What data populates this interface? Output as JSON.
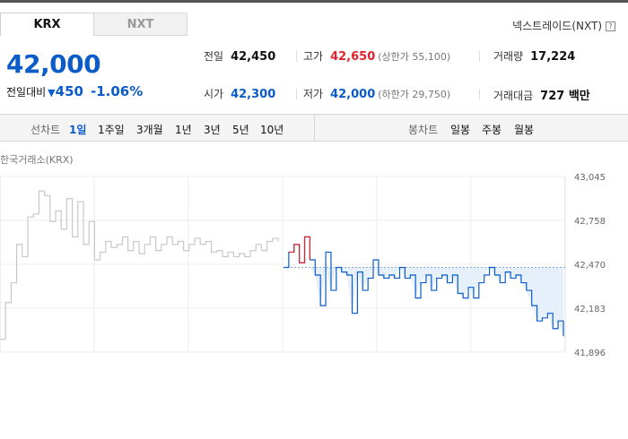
{
  "tabs": [
    {
      "label": "KRX",
      "active": true
    },
    {
      "label": "NXT",
      "active": false
    }
  ],
  "nxt_link": "넥스트레이드(NXT)",
  "price": "42,000",
  "change": {
    "label": "전일대비",
    "value": "450",
    "percent": "-1.06%"
  },
  "stats": {
    "prev_close": {
      "label": "전일",
      "value": "42,450"
    },
    "high": {
      "label": "고가",
      "value": "42,650",
      "sub_label": "(상한가 55,100)"
    },
    "volume": {
      "label": "거래량",
      "value": "17,224"
    },
    "open": {
      "label": "시가",
      "value": "42,300"
    },
    "low": {
      "label": "저가",
      "value": "42,000",
      "sub_label": "(하한가 29,750)"
    },
    "turnover": {
      "label": "거래대금",
      "value": "727 백만"
    }
  },
  "line_chart": {
    "label": "선차트",
    "periods": [
      "1일",
      "1주일",
      "3개월",
      "1년",
      "3년",
      "5년",
      "10년"
    ],
    "active": "1일"
  },
  "candle_chart": {
    "label": "봉차트",
    "periods": [
      "일봉",
      "주봉",
      "월봉"
    ]
  },
  "exchange_label": "한국거래소(KRX)",
  "colors": {
    "accent": "#0b5cc9",
    "up": "#e0242e",
    "prev_day": "#c8c8c8",
    "fill": "#e3eefb"
  },
  "chart_data": {
    "type": "line",
    "ylim": [
      41896,
      43045
    ],
    "yticks": [
      "43,045",
      "42,758",
      "42,470",
      "42,183",
      "41,896"
    ],
    "reference": 42450,
    "prev_day": [
      41980,
      42220,
      42350,
      42600,
      42520,
      42780,
      42800,
      42950,
      42920,
      42750,
      42820,
      42700,
      42900,
      42650,
      42880,
      42600,
      42750,
      42500,
      42550,
      42620,
      42580,
      42600,
      42650,
      42560,
      42620,
      42540,
      42600,
      42650,
      42560,
      42600,
      42650,
      42600,
      42620,
      42560,
      42600,
      42640,
      42600,
      42620,
      42550,
      42560,
      42520,
      42550,
      42520,
      42540,
      42520,
      42560,
      42600,
      42560,
      42620,
      42640,
      42620
    ],
    "today": [
      42450,
      42550,
      42600,
      42480,
      42650,
      42500,
      42400,
      42200,
      42550,
      42300,
      42450,
      42420,
      42400,
      42150,
      42420,
      42300,
      42380,
      42500,
      42400,
      42380,
      42400,
      42380,
      42450,
      42380,
      42400,
      42250,
      42350,
      42400,
      42300,
      42380,
      42400,
      42350,
      42400,
      42280,
      42250,
      42320,
      42250,
      42350,
      42400,
      42450,
      42400,
      42350,
      42420,
      42380,
      42400,
      42350,
      42300,
      42200,
      42100,
      42120,
      42150,
      42050,
      42100,
      42000
    ]
  }
}
